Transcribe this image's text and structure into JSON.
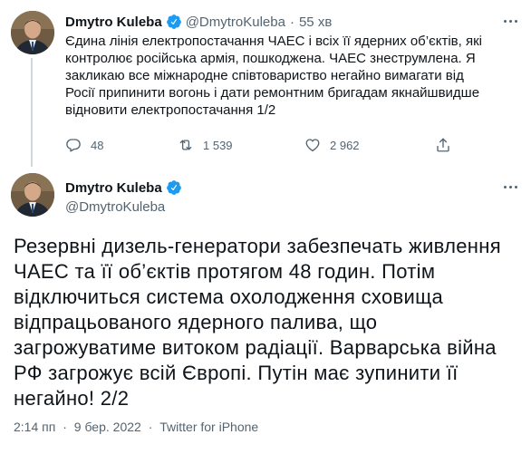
{
  "tweet1": {
    "author": {
      "name": "Dmytro Kuleba",
      "handle": "@DmytroKuleba"
    },
    "separator": "·",
    "time": "55 хв",
    "text": "Єдина лінія електропостачання ЧАЕС і всіх її ядерних об’єктів, які контролює російська армія, пошкоджена. ЧАЕС знеструмлена. Я закликаю все міжнародне співтовариство негайно вимагати від Росії припинити вогонь і дати ремонтним бригадам якнайшвидше відновити електропостачання 1/2",
    "actions": {
      "reply_count": "48",
      "retweet_count": "1 539",
      "like_count": "2 962"
    }
  },
  "tweet2": {
    "author": {
      "name": "Dmytro Kuleba",
      "handle": "@DmytroKuleba"
    },
    "text": "Резервні дизель-генератори забезпечать живлення ЧАЕС та її об’єктів протягом 48 годин. Потім відключиться система охолодження сховища відпрацьованого ядерного палива, що загрожуватиме витоком радіації. Варварська війна РФ загрожує всій Європі. Путін має зупинити її негайно! 2/2",
    "meta": {
      "time": "2:14 пп",
      "separator": "·",
      "date": "9 бер. 2022",
      "source": "Twitter for iPhone"
    }
  },
  "colors": {
    "text_primary": "#0f1419",
    "text_secondary": "#536471",
    "verified_blue": "#1d9bf0",
    "thread_line": "#cfd9de"
  },
  "icons": {
    "reply": "reply-icon",
    "retweet": "retweet-icon",
    "like": "heart-icon",
    "share": "share-icon",
    "more": "more-icon",
    "verified": "verified-badge-icon"
  }
}
